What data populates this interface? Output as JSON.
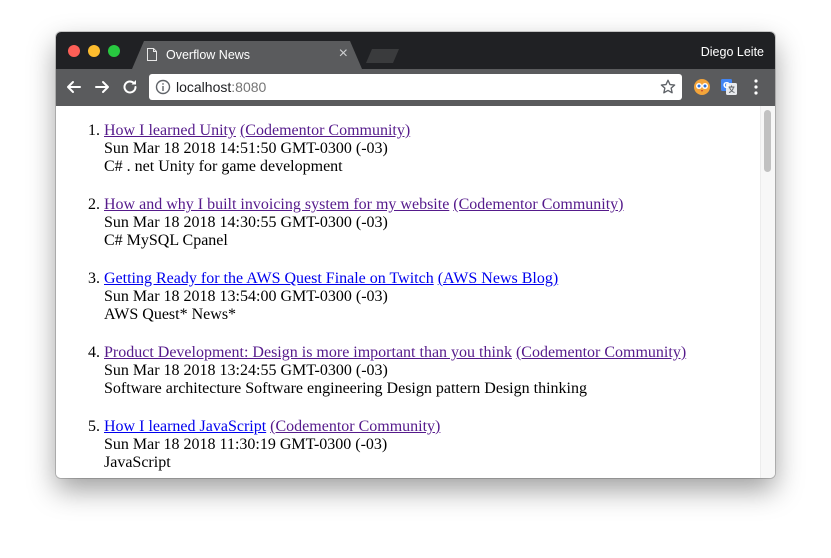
{
  "browser": {
    "tab_title": "Overflow News",
    "tab_close": "×",
    "profile_name": "Diego Leite",
    "url_host": "localhost",
    "url_port": ":8080"
  },
  "icons": {
    "back": "back-arrow-icon",
    "forward": "forward-arrow-icon",
    "reload": "reload-icon",
    "info": "info-icon",
    "star": "star-icon",
    "menu": "kebab-menu-icon"
  },
  "colors": {
    "link": "#0000ee",
    "visited": "#551a8b",
    "titlebar": "#202124",
    "toolbar": "#5a5b5d"
  },
  "news": [
    {
      "number": "1.",
      "title": "How I learned Unity",
      "source": "(Codementor Community)",
      "date": "Sun Mar 18 2018 14:51:50 GMT-0300 (-03)",
      "tags": "C# . net Unity for game development"
    },
    {
      "number": "2.",
      "title": "How and why I built invoicing system for my website",
      "source": "(Codementor Community)",
      "date": "Sun Mar 18 2018 14:30:55 GMT-0300 (-03)",
      "tags": "C# MySQL Cpanel"
    },
    {
      "number": "3.",
      "title": "Getting Ready for the AWS Quest Finale on Twitch",
      "source": "(AWS News Blog)",
      "date": "Sun Mar 18 2018 13:54:00 GMT-0300 (-03)",
      "tags": "AWS Quest* News*"
    },
    {
      "number": "4.",
      "title": "Product Development: Design is more important than you think",
      "source": "(Codementor Community)",
      "date": "Sun Mar 18 2018 13:24:55 GMT-0300 (-03)",
      "tags": "Software architecture Software engineering Design pattern Design thinking"
    },
    {
      "number": "5.",
      "title": "How I learned JavaScript",
      "source": "(Codementor Community)",
      "date": "Sun Mar 18 2018 11:30:19 GMT-0300 (-03)",
      "tags": "JavaScript"
    }
  ]
}
